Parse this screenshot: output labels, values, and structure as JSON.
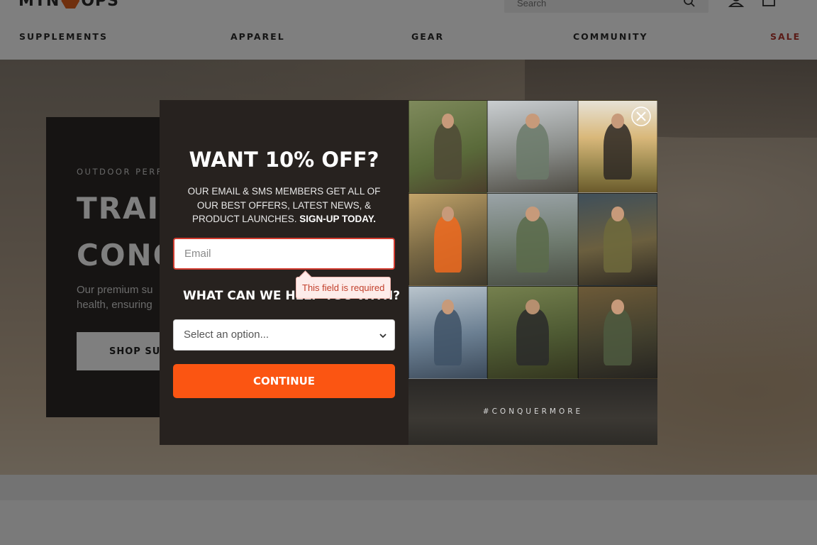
{
  "header": {
    "logo_left": "MTN",
    "logo_right": "OPS",
    "search_placeholder": "Search",
    "nav": [
      {
        "label": "SUPPLEMENTS"
      },
      {
        "label": "APPAREL"
      },
      {
        "label": "GEAR"
      },
      {
        "label": "COMMUNITY"
      },
      {
        "label": "SALE",
        "color": "#b4372f"
      }
    ]
  },
  "hero": {
    "eyebrow": "OUTDOOR PERF",
    "title_line1": "TRAIN",
    "title_line2": "CONQ",
    "description_line1": "Our premium su",
    "description_line2": "health, ensuring",
    "button_label": "SHOP SUP"
  },
  "modal": {
    "headline": "WANT 10% OFF?",
    "subtext": "OUR EMAIL & SMS MEMBERS GET ALL OF OUR BEST OFFERS, LATEST NEWS, & PRODUCT LAUNCHES.",
    "subtext_bold": "SIGN-UP TODAY.",
    "email_placeholder": "Email",
    "email_value": "",
    "error_message": "This field is required",
    "help_heading": "WHAT CAN WE HELP YOU WITH?",
    "select_value": "Select an option...",
    "continue_label": "CONTINUE",
    "hashtag": "#CONQUERMORE"
  },
  "colors": {
    "accent_orange": "#fb5512",
    "sale_red": "#b4372f",
    "error_red": "#d23b2f",
    "modal_bg": "#27221f"
  }
}
